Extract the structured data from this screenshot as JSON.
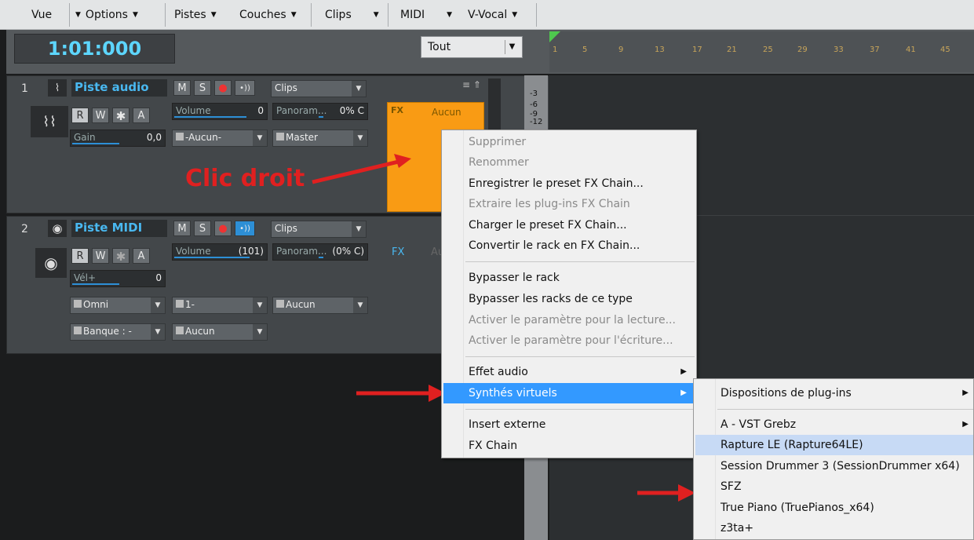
{
  "menubar": [
    "Vue",
    "Options",
    "Pistes",
    "Couches",
    "Clips",
    "MIDI",
    "V-Vocal"
  ],
  "toolbar": {
    "timecode": "1:01:000",
    "filter": "Tout"
  },
  "ruler": [
    "1",
    "5",
    "9",
    "13",
    "17",
    "21",
    "25",
    "29",
    "33",
    "37",
    "41",
    "45"
  ],
  "tracks": {
    "audio": {
      "num": "1",
      "name": "Piste audio",
      "mute": "M",
      "solo": "S",
      "r": "R",
      "w": "W",
      "a": "A",
      "clips": "Clips",
      "volume_label": "Volume",
      "volume_value": "0",
      "pan_label": "Panoram...",
      "pan_value": "0% C",
      "gain_label": "Gain",
      "gain_value": "0,0",
      "input": "-Aucun-",
      "output": "Master",
      "fx_label": "Aucun"
    },
    "midi": {
      "num": "2",
      "name": "Piste MIDI",
      "mute": "M",
      "solo": "S",
      "r": "R",
      "w": "W",
      "a": "A",
      "clips": "Clips",
      "volume_label": "Volume",
      "volume_value": "(101)",
      "pan_label": "Panoram...",
      "pan_value": "(0% C)",
      "vel_label": "Vél+",
      "vel_value": "0",
      "channel_omni": "Omni",
      "port": "1-",
      "output": "Aucun",
      "bank": "Banque : -",
      "patch": "Aucun",
      "fx_label": "FX",
      "fx_hint": "Au"
    }
  },
  "db_scale": [
    "-3",
    "-6",
    "-9",
    "-12"
  ],
  "annotation": "Clic droit",
  "context_menu": [
    {
      "label": "Supprimer",
      "disabled": true
    },
    {
      "label": "Renommer",
      "disabled": true
    },
    {
      "label": "Enregistrer le preset FX Chain...",
      "disabled": false
    },
    {
      "label": "Extraire les plug-ins FX Chain",
      "disabled": true
    },
    {
      "label": "Charger le preset FX Chain...",
      "disabled": false
    },
    {
      "label": "Convertir le rack en FX Chain...",
      "disabled": false
    },
    {
      "label": "Bypasser le rack",
      "disabled": false
    },
    {
      "label": "Bypasser les racks de ce type",
      "disabled": false
    },
    {
      "label": "Activer le paramètre pour la lecture...",
      "disabled": true
    },
    {
      "label": "Activer le paramètre pour l'écriture...",
      "disabled": true
    },
    {
      "label": "Effet audio",
      "disabled": false
    },
    {
      "label": "Synthés virtuels",
      "disabled": false
    },
    {
      "label": "Insert externe",
      "disabled": false
    },
    {
      "label": "FX Chain",
      "disabled": false
    }
  ],
  "submenu": [
    {
      "label": "Dispositions de plug-ins"
    },
    {
      "label": "A - VST Grebz"
    },
    {
      "label": "Rapture LE (Rapture64LE)"
    },
    {
      "label": "Session Drummer 3 (SessionDrummer x64)"
    },
    {
      "label": "SFZ"
    },
    {
      "label": "True Piano (TruePianos_x64)"
    },
    {
      "label": "z3ta+"
    }
  ],
  "colors": {
    "accent": "#49b8f0",
    "fx_rack": "#f99b14",
    "highlight": "#3399ff",
    "annotation": "#e02020"
  }
}
